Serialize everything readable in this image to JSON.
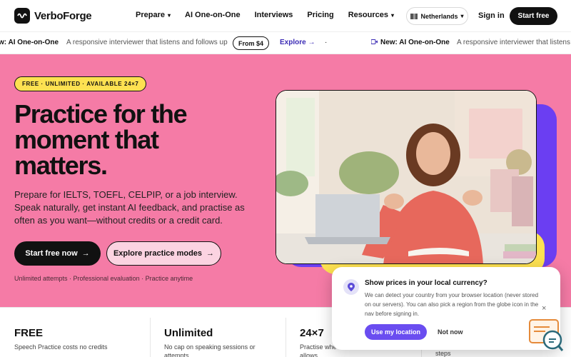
{
  "brand": {
    "name": "VerboForge"
  },
  "nav": {
    "links": [
      {
        "label": "Prepare",
        "dropdown": true
      },
      {
        "label": "AI One-on-One",
        "dropdown": false
      },
      {
        "label": "Interviews",
        "dropdown": false
      },
      {
        "label": "Pricing",
        "dropdown": false
      },
      {
        "label": "Resources",
        "dropdown": true
      }
    ],
    "locale": "Netherlands",
    "signin": "Sign in",
    "cta": "Start free"
  },
  "ticker": {
    "items": [
      {
        "title": "w: AI One-on-One",
        "text": "A responsive interviewer that listens and follows up"
      },
      {
        "pill": "From $4"
      },
      {
        "link": "Explore"
      },
      {
        "title": "New: AI One-on-One",
        "text": "A responsive interviewer that listens a"
      }
    ],
    "bullet": "·"
  },
  "hero": {
    "badge": "FREE · UNLIMITED · AVAILABLE 24×7",
    "headline": "Practice for the moment that matters.",
    "subcopy": "Prepare for IELTS, TOEFL, CELPIP, or a job interview. Speak naturally, get instant AI feedback, and practise as often as you want—without credits or a credit card.",
    "primary_cta": "Start free now",
    "secondary_cta": "Explore practice modes",
    "fineprint": "Unlimited attempts · Professional evaluation · Practice anytime",
    "arrow": "→"
  },
  "stats": [
    {
      "title": "FREE",
      "desc": "Speech Practice costs no credits"
    },
    {
      "title": "Unlimited",
      "desc": "No cap on speaking sessions or attempts"
    },
    {
      "title": "24×7",
      "desc": "Practise whe allows"
    },
    {
      "title": "",
      "desc": "steps"
    }
  ],
  "popup": {
    "title": "Show prices in your local currency?",
    "body": "We can detect your country from your browser location (never stored on our servers). You can also pick a region from the globe icon in the nav before signing in.",
    "use_label": "Use my location",
    "not_label": "Not now",
    "close": "×"
  },
  "colors": {
    "hero_bg": "#f57ba6",
    "badge_bg": "#fde151",
    "accent_purple": "#6b3ef2",
    "button_purple": "#6a4df0"
  }
}
